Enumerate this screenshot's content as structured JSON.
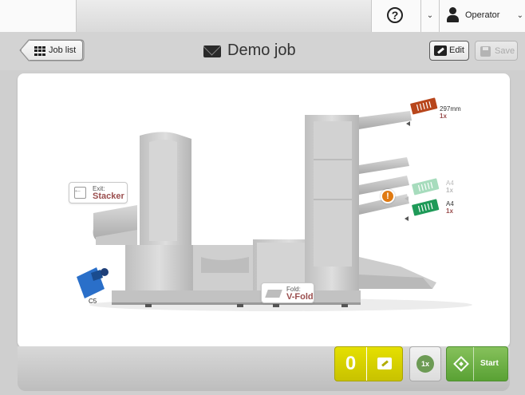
{
  "topbar": {
    "help_symbol": "?",
    "chevron": "⌄",
    "user_name": "Operator",
    "user_chevron": "⌄"
  },
  "header": {
    "back_label": "Job list",
    "title": "Demo job",
    "edit_label": "Edit",
    "save_label": "Save"
  },
  "machine": {
    "exit": {
      "caption": "Exit:",
      "value": "Stacker"
    },
    "fold": {
      "caption": "Fold:",
      "value": "V-Fold"
    },
    "envelope_label": "C5",
    "warning_symbol": "!",
    "feeders": [
      {
        "size": "297mm",
        "count": "1x",
        "color": "#b8461c",
        "state": "active"
      },
      {
        "size": "A4",
        "count": "1x",
        "color": "#9ad7b2",
        "state": "disabled"
      },
      {
        "size": "A4",
        "count": "1x",
        "color": "#1e9a58",
        "state": "active"
      }
    ]
  },
  "bottom": {
    "counter_value": "0",
    "copies_label": "1x",
    "start_label": "Start"
  },
  "colors": {
    "accent_yellow": "#d9d400",
    "start_green": "#6aae42",
    "warning_orange": "#e07a12",
    "label_red": "#9a4e4e"
  }
}
